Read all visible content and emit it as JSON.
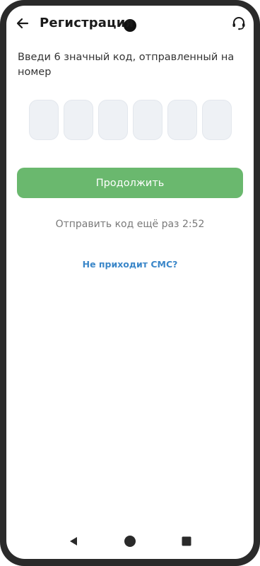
{
  "header": {
    "title": "Регистрация"
  },
  "instruction": {
    "text": "Введи 6 значный код, отправленный на номер"
  },
  "code_input": {
    "length": 6
  },
  "buttons": {
    "continue_label": "Продолжить"
  },
  "resend": {
    "text": "Отправить код ещё раз 2:52"
  },
  "help": {
    "no_sms_label": "Не приходит СМС?"
  },
  "colors": {
    "accent_green": "#6ab86e",
    "link_blue": "#3b87c9",
    "code_cell_bg": "#eef1f5"
  },
  "icons": {
    "back": "arrow-left-icon",
    "support": "headset-icon",
    "nav_back": "triangle-back-icon",
    "nav_home": "circle-home-icon",
    "nav_recent": "square-recent-icon"
  }
}
